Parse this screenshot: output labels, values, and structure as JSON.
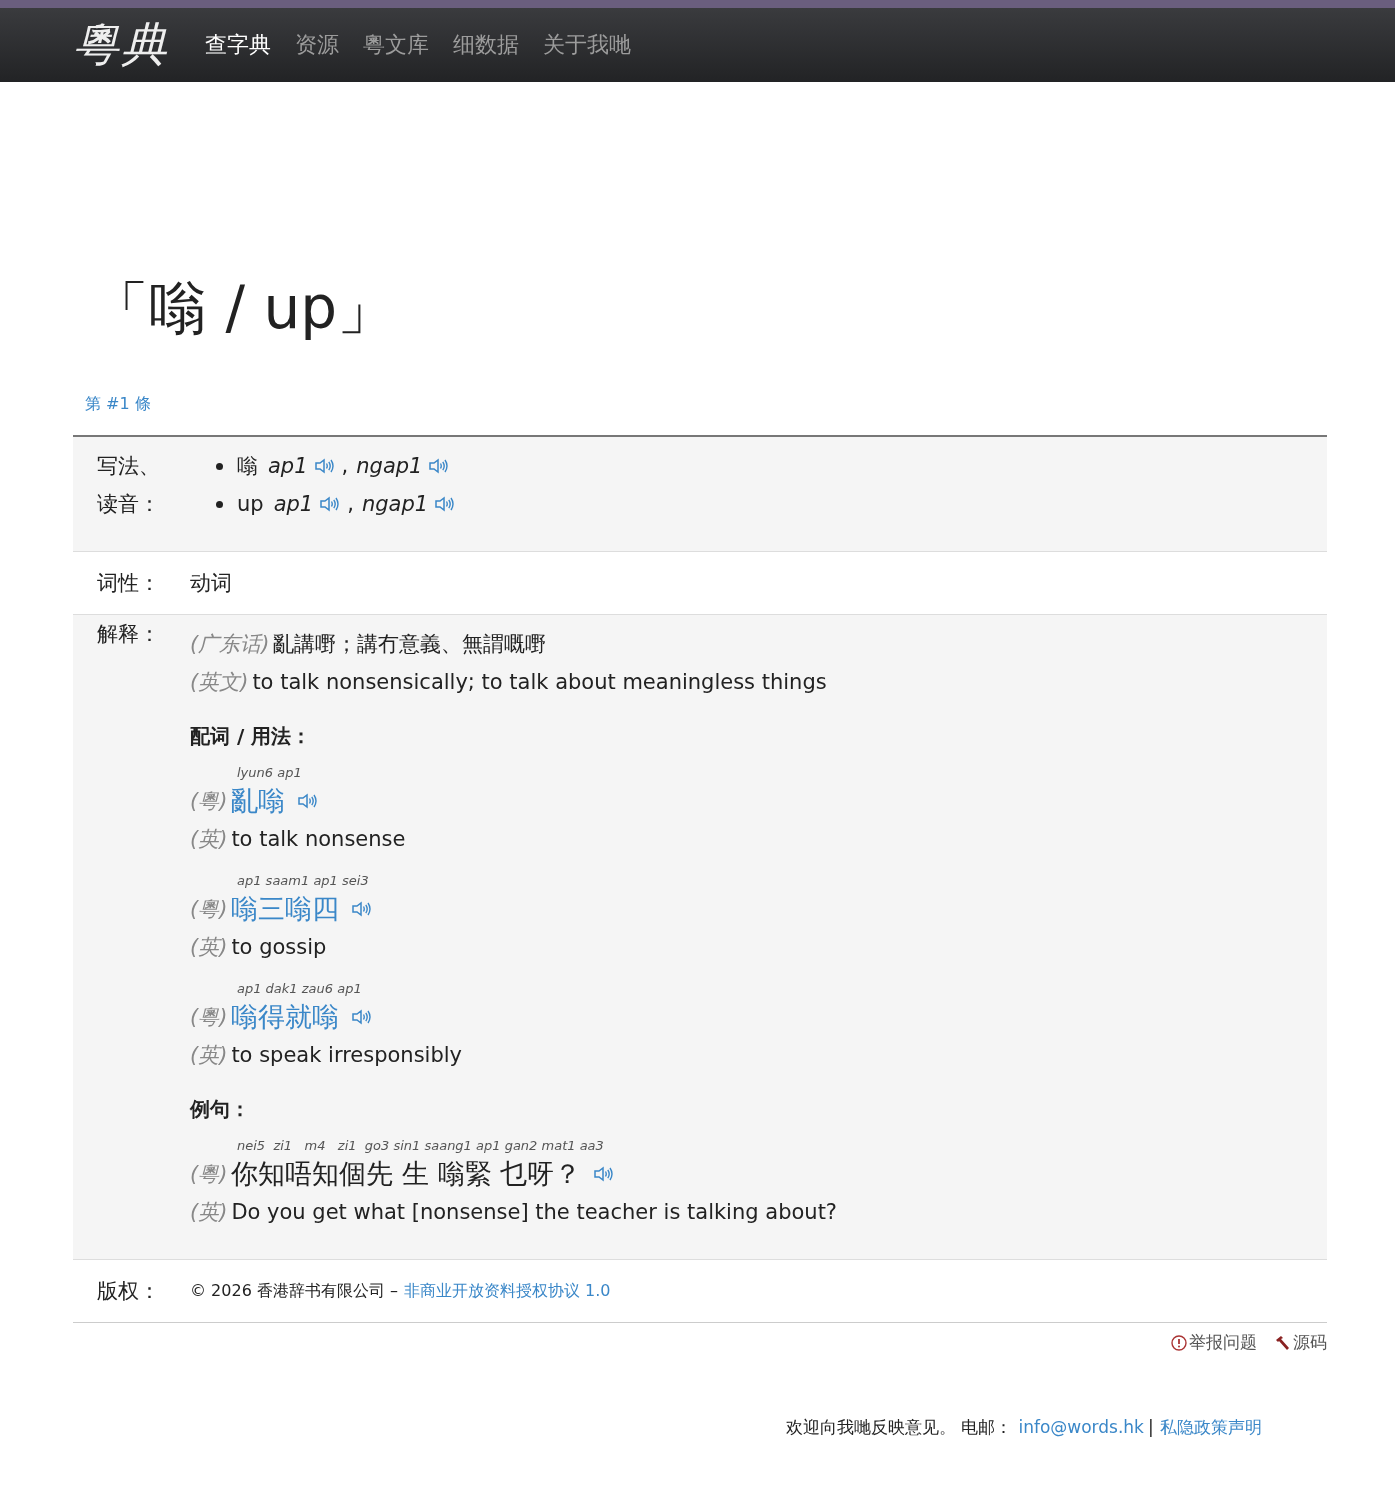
{
  "nav": {
    "logo": "粵典",
    "items": [
      {
        "label": "查字典",
        "selected": true
      },
      {
        "label": "资源",
        "selected": false
      },
      {
        "label": "粵文库",
        "selected": false
      },
      {
        "label": "细数据",
        "selected": false
      },
      {
        "label": "关于我哋",
        "selected": false
      }
    ]
  },
  "headword": "「嗡 / up」",
  "entry_label": "第 #1 條",
  "readings": {
    "labels": [
      "写法、",
      "读音："
    ],
    "items": [
      {
        "word": "嗡",
        "prons": [
          "ap1",
          "ngap1"
        ],
        "separator": ","
      },
      {
        "word": "up",
        "prons": [
          "ap1",
          "ngap1"
        ],
        "separator": ","
      }
    ]
  },
  "part_of_speech": {
    "label": "词性：",
    "value": "动词"
  },
  "explanation": {
    "label": "解释：",
    "definitions": [
      {
        "lang": "(广东话)",
        "text": "亂講嘢；講冇意義、無謂嘅嘢"
      },
      {
        "lang": "(英文)",
        "text": "to talk nonsensically; to talk about meaningless things"
      }
    ],
    "collocations_heading": "配词 / 用法：",
    "collocations": [
      {
        "jyutping": "lyun6 ap1",
        "yue_tag": "(粵)",
        "word": "亂嗡",
        "en_tag": "(英)",
        "meaning": "to talk nonsense"
      },
      {
        "jyutping": "ap1 saam1 ap1 sei3",
        "yue_tag": "(粵)",
        "word": "嗡三嗡四",
        "en_tag": "(英)",
        "meaning": "to gossip"
      },
      {
        "jyutping": "ap1 dak1 zau6 ap1",
        "yue_tag": "(粵)",
        "word": "嗡得就嗡",
        "en_tag": "(英)",
        "meaning": "to speak irresponsibly"
      }
    ],
    "examples_heading": "例句：",
    "examples": [
      {
        "jyutping": "nei5  zi1   m4   zi1  go3 sin1 saang1 ap1 gan2 mat1 aa3",
        "yue_tag": "(粵)",
        "text": "你知唔知個先 生 嗡緊 乜呀？",
        "en_tag": "(英)",
        "translation": "Do you get what [nonsense] the teacher is talking about?"
      }
    ]
  },
  "copyright": {
    "label": "版权：",
    "text": "© 2026 香港辞书有限公司 –",
    "link": "非商业开放资料授权协议 1.0"
  },
  "actions": [
    {
      "kind": "report",
      "label": "举报问题"
    },
    {
      "kind": "source",
      "label": "源码"
    }
  ],
  "footer": {
    "text": "欢迎向我哋反映意见。 电邮：",
    "email": "info@words.hk",
    "separator": "|",
    "privacy": "私隐政策声明"
  }
}
